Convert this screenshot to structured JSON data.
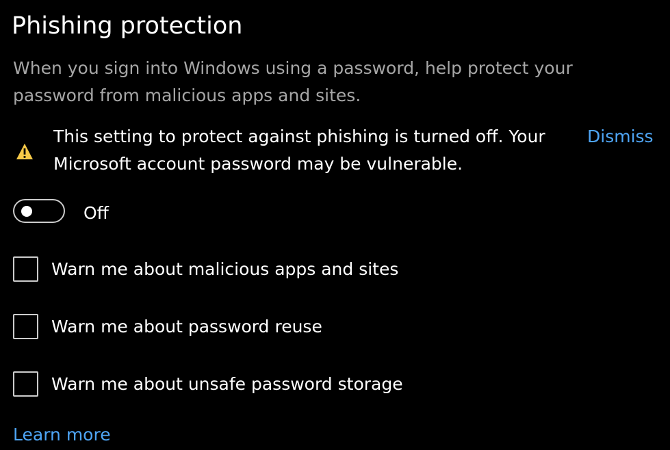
{
  "title": "Phishing protection",
  "description": "When you sign into Windows using a password, help protect your password from malicious apps and sites.",
  "warning": {
    "icon": "warning-icon",
    "text": "This setting to protect against phishing is turned off. Your Microsoft account password may be vulnerable.",
    "dismiss_label": "Dismiss"
  },
  "toggle": {
    "state": "off",
    "label": "Off"
  },
  "checkboxes": [
    {
      "label": "Warn me about malicious apps and sites",
      "checked": false
    },
    {
      "label": "Warn me about password reuse",
      "checked": false
    },
    {
      "label": "Warn me about unsafe password storage",
      "checked": false
    }
  ],
  "learn_more_label": "Learn more",
  "colors": {
    "background": "#000000",
    "text": "#ffffff",
    "secondary_text": "#a6a6a6",
    "link": "#4ea5f5",
    "warning_icon": "#f7c948"
  }
}
